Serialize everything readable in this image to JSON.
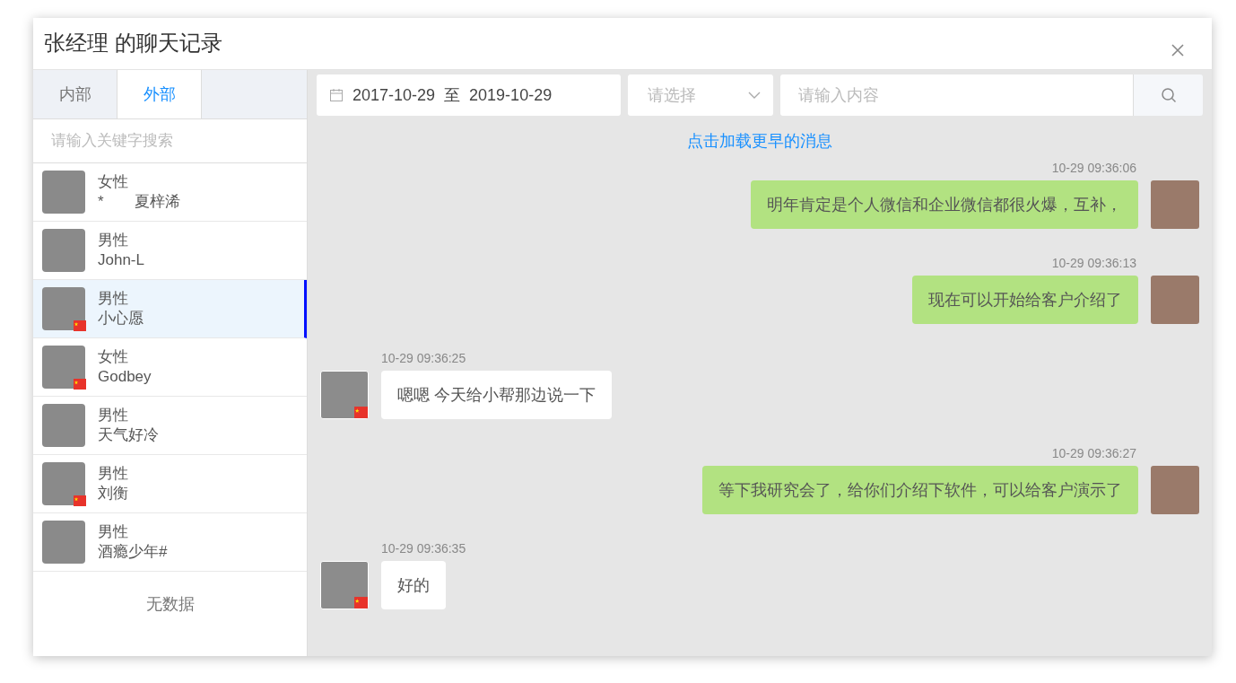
{
  "window": {
    "title": "张经理 的聊天记录"
  },
  "tabs": [
    {
      "label": "内部",
      "selected": false
    },
    {
      "label": "外部",
      "selected": true
    }
  ],
  "search": {
    "placeholder": "请输入关键字搜索"
  },
  "contacts": [
    {
      "gender": "女性",
      "name": "*　　夏梓浠",
      "selected": false,
      "flag": false
    },
    {
      "gender": "男性",
      "name": "John-L",
      "selected": false,
      "flag": false
    },
    {
      "gender": "男性",
      "name": "小心愿",
      "selected": true,
      "flag": true
    },
    {
      "gender": "女性",
      "name": "Godbey",
      "selected": false,
      "flag": true
    },
    {
      "gender": "男性",
      "name": "天气好冷",
      "selected": false,
      "flag": false
    },
    {
      "gender": "男性",
      "name": "刘衡",
      "selected": false,
      "flag": true
    },
    {
      "gender": "男性",
      "name": "酒瘾少年#",
      "selected": false,
      "flag": false
    }
  ],
  "empty_text": "无数据",
  "filters": {
    "date_from": "2017-10-29",
    "date_sep": "至",
    "date_to": "2019-10-29",
    "select_placeholder": "请选择",
    "content_placeholder": "请输入内容"
  },
  "load_more": "点击加载更早的消息",
  "messages": [
    {
      "kind": "sent",
      "time": "10-29 09:36:06",
      "text": "明年肯定是个人微信和企业微信都很火爆，互补，",
      "flag": false
    },
    {
      "kind": "sent",
      "time": "10-29 09:36:13",
      "text": "现在可以开始给客户介绍了",
      "flag": false
    },
    {
      "kind": "received",
      "time": "10-29 09:36:25",
      "text": "嗯嗯 今天给小帮那边说一下",
      "flag": true
    },
    {
      "kind": "sent",
      "time": "10-29 09:36:27",
      "text": "等下我研究会了，给你们介绍下软件，可以给客户演示了",
      "flag": false
    },
    {
      "kind": "received",
      "time": "10-29 09:36:35",
      "text": "好的",
      "flag": true
    }
  ]
}
